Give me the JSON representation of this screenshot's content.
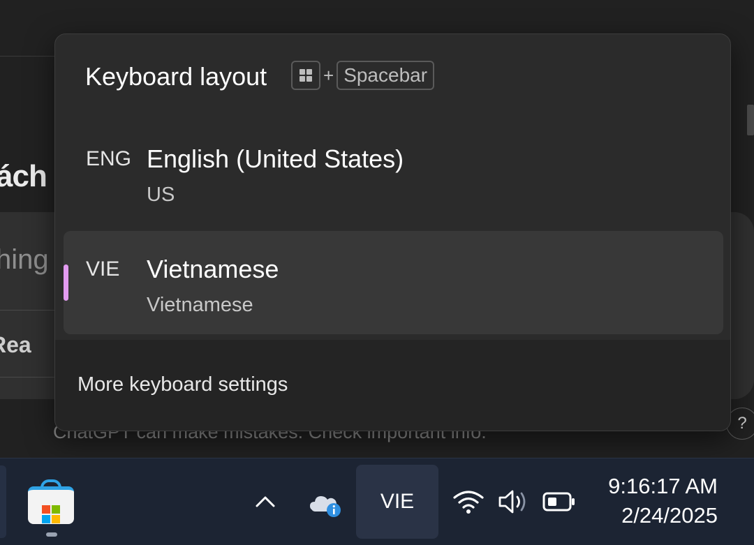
{
  "background_app": {
    "heading_fragment": "ách",
    "placeholder_fragment": "hing",
    "reason_fragment": "Rea",
    "footer_note": "ChatGPT can make mistakes. Check important info.",
    "help_label": "?"
  },
  "flyout": {
    "title": "Keyboard layout",
    "shortcut": {
      "icon": "windows-key-icon",
      "plus": "+",
      "key": "Spacebar"
    },
    "languages": [
      {
        "code": "ENG",
        "name": "English (United States)",
        "layout": "US",
        "selected": false
      },
      {
        "code": "VIE",
        "name": "Vietnamese",
        "layout": "Vietnamese",
        "selected": true
      }
    ],
    "more_settings_label": "More keyboard settings",
    "accent_color": "#e29bf0"
  },
  "taskbar": {
    "pinned": [
      {
        "icon": "microsoft-store-icon",
        "running": true
      }
    ],
    "tray": {
      "overflow_icon": "chevron-up-icon",
      "onedrive_icon": "onedrive-info-icon",
      "language_indicator": "VIE",
      "wifi_icon": "wifi-icon",
      "volume_icon": "volume-icon",
      "battery_icon": "battery-icon"
    },
    "clock": {
      "time": "9:16:17 AM",
      "date": "2/24/2025"
    }
  },
  "colors": {
    "app_background": "#212121",
    "flyout_background": "#2b2b2b",
    "selected_item": "#383838",
    "taskbar_background": "#1c2433",
    "accent": "#e29bf0"
  }
}
